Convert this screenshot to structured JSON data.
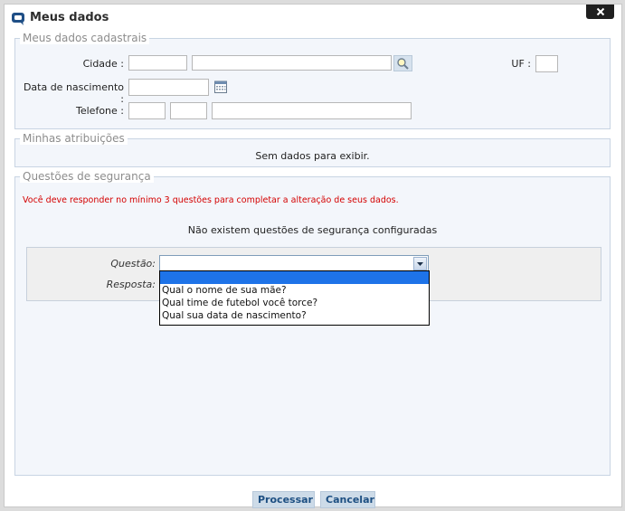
{
  "window": {
    "title": "Meus dados",
    "close_icon": "close-x-icon"
  },
  "cadastrais": {
    "legend": "Meus dados cadastrais",
    "cidade_label": "Cidade :",
    "uf_label": "UF :",
    "nascimento_label": "Data de nascimento :",
    "telefone_label": "Telefone :",
    "cidade_code": "",
    "cidade_name": "",
    "uf": "",
    "nascimento": "",
    "tel_ddi": "",
    "tel_ddd": "",
    "tel_numero": ""
  },
  "atribuicoes": {
    "legend": "Minhas atribuições",
    "empty_text": "Sem dados para exibir."
  },
  "seguranca": {
    "legend": "Questões de segurança",
    "warning": "Você deve responder no mínimo 3 questões para completar a alteração de seus dados.",
    "none_configured": "Não existem questões de segurança configuradas",
    "questao_label": "Questão:",
    "resposta_label": "Resposta:",
    "questao_selected": "",
    "options": [
      "",
      "Qual o nome de sua mãe?",
      "Qual time de futebol você torce?",
      "Qual sua data de nascimento?"
    ]
  },
  "footer": {
    "processar_label": "Processar",
    "cancelar_label": "Cancelar"
  },
  "colors": {
    "accent": "#1d4f82",
    "warning": "#d40000",
    "selection": "#1e73e8"
  }
}
